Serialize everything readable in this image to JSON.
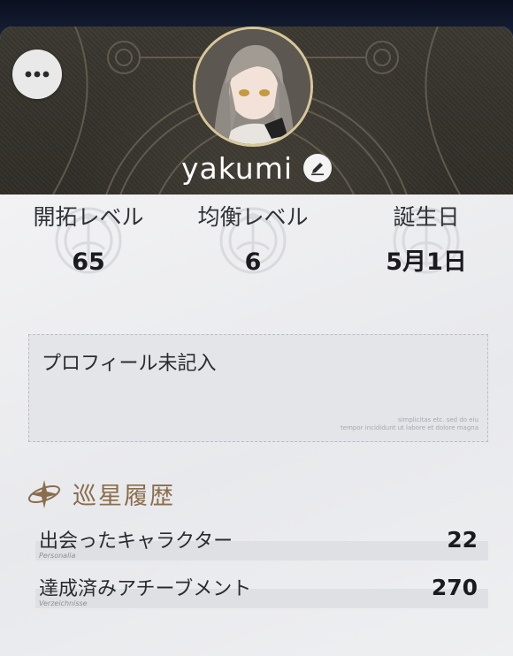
{
  "profile": {
    "username": "yakumi"
  },
  "stats": [
    {
      "label": "開拓レベル",
      "value": "65"
    },
    {
      "label": "均衡レベル",
      "value": "6"
    },
    {
      "label": "誕生日",
      "value": "5月1日"
    }
  ],
  "bio": {
    "text": "プロフィール未記入",
    "deco_line1": "simplicitas etc. sed do eiu",
    "deco_line2": "tempor incididunt ut labore et dolore magna"
  },
  "records": {
    "title": "巡星履歴",
    "items": [
      {
        "label": "出会ったキャラクター",
        "sublabel": "Personalia",
        "value": "22"
      },
      {
        "label": "達成済みアチーブメント",
        "sublabel": "Verzeichnisse",
        "value": "270"
      }
    ]
  },
  "icons": {
    "more": "more-dots-icon",
    "edit": "pencil-icon",
    "section": "star-compass-icon",
    "emblem": "stat-emblem-icon"
  },
  "colors": {
    "header_bg": "#34312b",
    "accent_gold": "#d8c79a",
    "section_title": "#8a6d4c",
    "card_bg": "#ecedf0"
  }
}
